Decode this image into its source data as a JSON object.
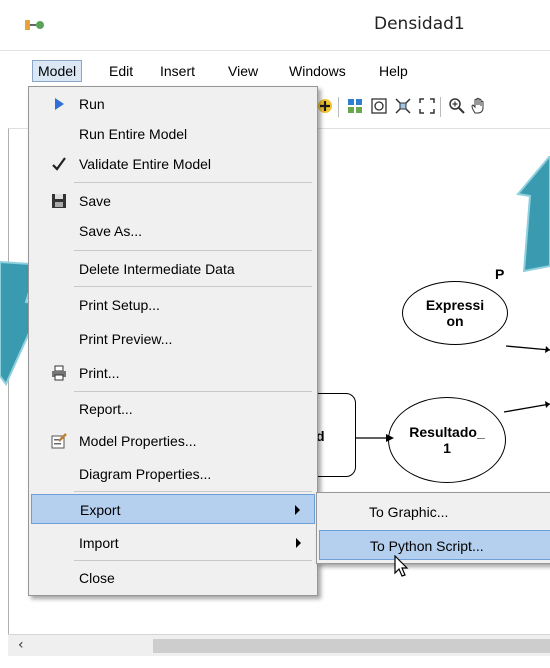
{
  "window": {
    "title": "Densidad1"
  },
  "menubar": {
    "items": [
      {
        "label": "Model",
        "active": true
      },
      {
        "label": "Edit"
      },
      {
        "label": "Insert"
      },
      {
        "label": "View"
      },
      {
        "label": "Windows"
      },
      {
        "label": "Help"
      }
    ]
  },
  "toolbar": {
    "icons": [
      "add-data-icon",
      "auto-layout-icon",
      "select-all-icon",
      "full-extent-icon",
      "fit-icon",
      "zoom-in-icon",
      "pan-hand-icon"
    ]
  },
  "model_menu": {
    "items": [
      {
        "label": "Run",
        "icon": "run-arrow-icon"
      },
      {
        "label": "Run Entire Model"
      },
      {
        "label": "Validate Entire Model",
        "icon": "checkmark-icon"
      },
      {
        "label": "Save",
        "icon": "floppy-disk-icon"
      },
      {
        "label": "Save As..."
      },
      {
        "label": "Delete Intermediate Data"
      },
      {
        "label": "Print Setup..."
      },
      {
        "label": "Print Preview..."
      },
      {
        "label": "Print...",
        "icon": "printer-icon"
      },
      {
        "label": "Report..."
      },
      {
        "label": "Model Properties...",
        "icon": "properties-icon"
      },
      {
        "label": "Diagram Properties..."
      },
      {
        "label": "Export",
        "submenu": true,
        "highlighted": true
      },
      {
        "label": "Import",
        "submenu": true
      },
      {
        "label": "Close"
      }
    ]
  },
  "export_submenu": {
    "items": [
      {
        "label": "To Graphic..."
      },
      {
        "label": "To Python Script...",
        "highlighted": true
      }
    ]
  },
  "diagram": {
    "nodes": [
      {
        "label": "Expressi\non",
        "tag": "P"
      },
      {
        "label": "Resultado_\n1"
      },
      {
        "label": "d"
      }
    ]
  },
  "colors": {
    "highlight": "#b5cfee",
    "annotation_arrow": "#3a9ab0"
  }
}
